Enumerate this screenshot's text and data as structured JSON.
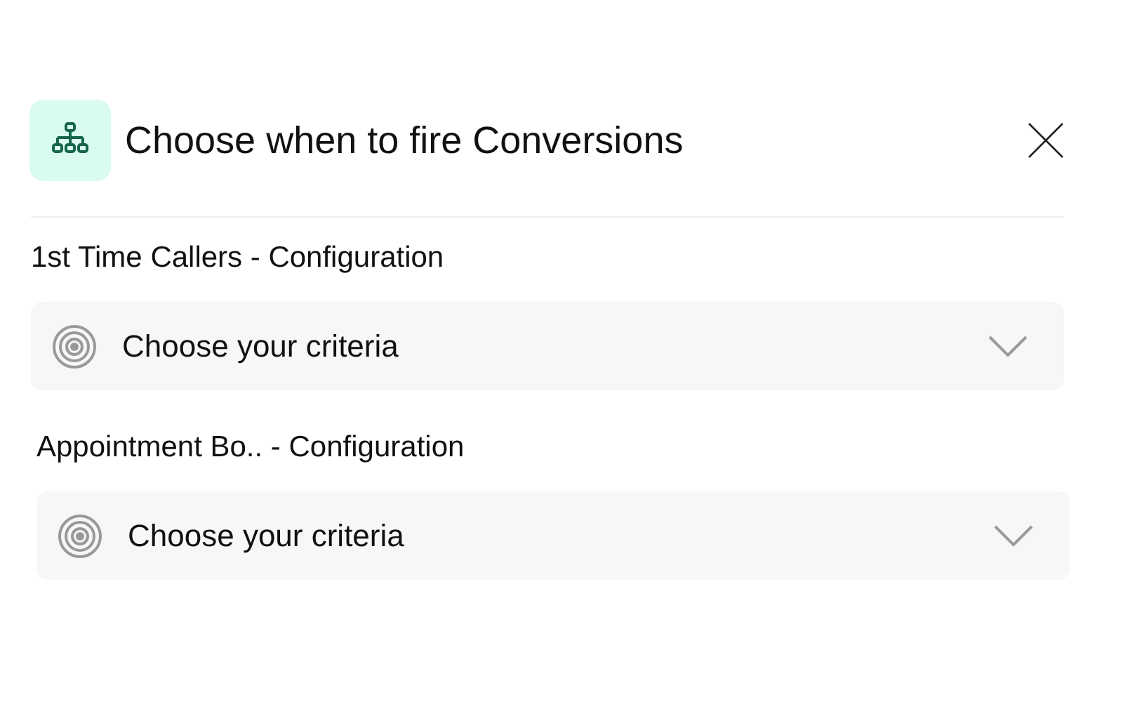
{
  "dialog": {
    "title": "Choose when to fire Conversions"
  },
  "sections": [
    {
      "label": "1st Time Callers - Configuration",
      "select": {
        "placeholder": "Choose your criteria"
      }
    },
    {
      "label": "Appointment Bo.. - Configuration",
      "select": {
        "placeholder": "Choose your criteria"
      }
    }
  ]
}
